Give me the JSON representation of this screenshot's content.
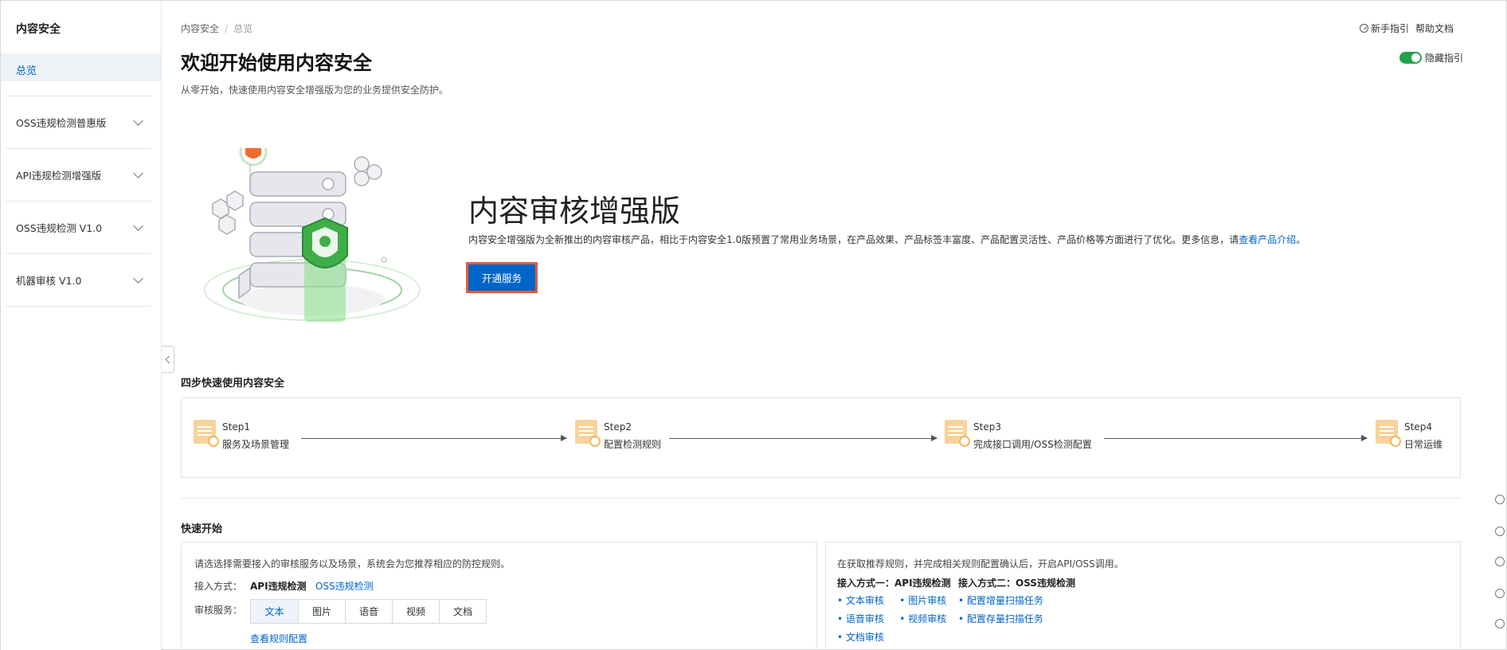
{
  "sidebar": {
    "title": "内容安全",
    "active_item": "总览",
    "groups": [
      {
        "label": "OSS违规检测普惠版"
      },
      {
        "label": "API违规检测增强版"
      },
      {
        "label": "OSS违规检测 V1.0"
      },
      {
        "label": "机器审核 V1.0"
      }
    ]
  },
  "header": {
    "breadcrumb": [
      "内容安全",
      "总览"
    ],
    "title": "欢迎开始使用内容安全",
    "subtitle": "从零开始，快速使用内容安全增强版为您的业务提供安全防护。",
    "guide_link": "新手指引",
    "help_link": "帮助文档",
    "hide_guide_label": "隐藏指引",
    "hide_guide_on": true
  },
  "hero": {
    "title": "内容审核增强版",
    "desc": "内容安全增强版为全新推出的内容审核产品，相比于内容安全1.0版预置了常用业务场景，在产品效果、产品标签丰富度、产品配置灵活性、产品价格等方面进行了优化。更多信息，请",
    "desc_link": "查看产品介绍",
    "desc_end": "。",
    "button": "开通服务"
  },
  "steps": {
    "title": "四步快速使用内容安全",
    "items": [
      {
        "step": "Step1",
        "label": "服务及场景管理"
      },
      {
        "step": "Step2",
        "label": "配置检测规则"
      },
      {
        "step": "Step3",
        "label": "完成接口调用/OSS检测配置"
      },
      {
        "step": "Step4",
        "label": "日常运维"
      }
    ]
  },
  "quick_start": {
    "title": "快速开始",
    "left": {
      "desc": "请选选择需要接入的审核服务以及场景，系统会为您推荐相应的防控规则。",
      "access_label": "接入方式：",
      "access_api": "API违规检测",
      "access_oss": "OSS违规检测",
      "service_label": "审核服务：",
      "tabs": [
        "文本",
        "图片",
        "语音",
        "视频",
        "文档"
      ],
      "rule_link": "查看规则配置"
    },
    "right": {
      "desc": "在获取推荐规则，并完成相关规则配置确认后，开启API/OSS调用。",
      "col1_head": "接入方式一：API违规检测",
      "col1_items": [
        "文本审核",
        "图片审核",
        "语音审核",
        "视频审核",
        "文档审核"
      ],
      "col2_head": "接入方式二：OSS违规检测",
      "col2_items": [
        "配置增量扫描任务",
        "配置存量扫描任务"
      ]
    }
  },
  "colors": {
    "accent": "#0064c8",
    "toggle_on": "#23a34a",
    "highlight": "#e25d3d"
  }
}
